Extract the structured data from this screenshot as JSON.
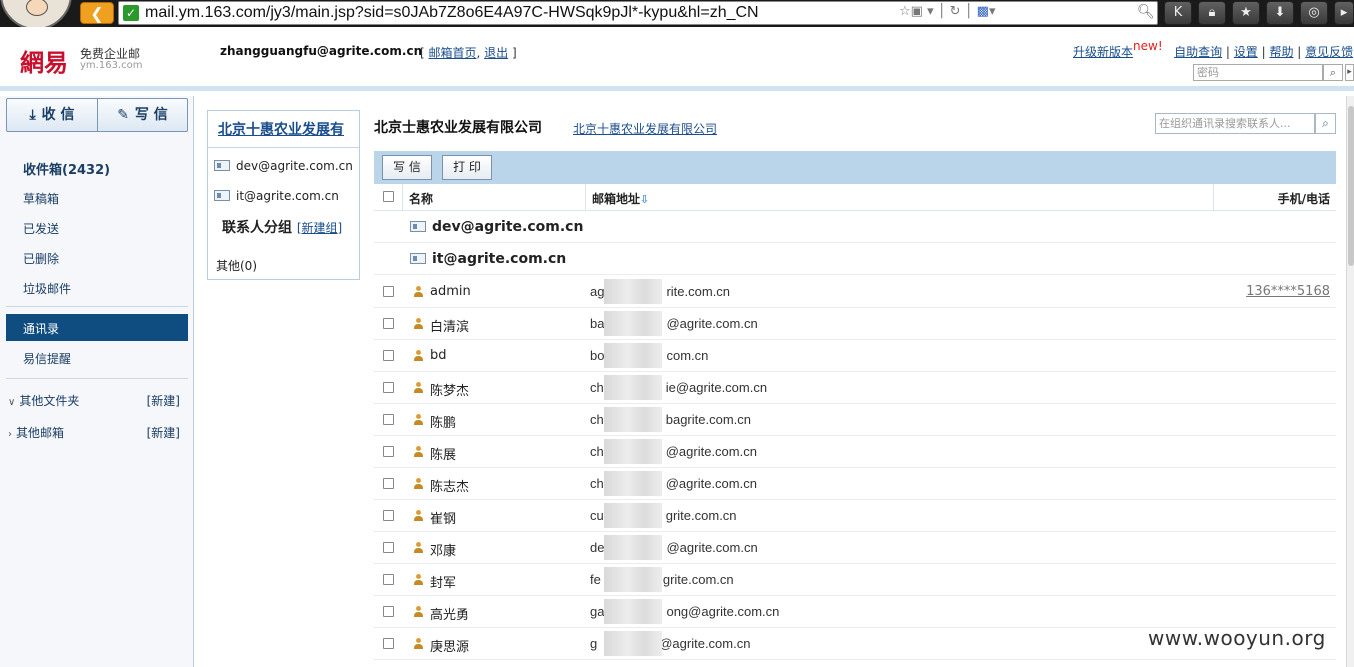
{
  "browser": {
    "url": "mail.ym.163.com/jy3/main.jsp?sid=s0JAb7Z8o6E4A97C-HWSqk9pJl*-kypu&hl=zh_CN"
  },
  "header": {
    "logo": "網易",
    "logo_sub": "免费企业邮",
    "logo_domain": "ym.163.com",
    "user_email": "zhangguangfu@agrite.com.cn",
    "link_home": "邮箱首页",
    "link_logout": "退出",
    "link_upgrade": "升级新版本",
    "new_badge": "new!",
    "link_help_self": "自助查询",
    "link_settings": "设置",
    "link_help": "帮助",
    "link_feedback": "意见反馈",
    "password_placeholder": "密码"
  },
  "sidebar": {
    "receive_label": "收 信",
    "compose_label": "写 信",
    "items": [
      {
        "label": "收件箱(2432)"
      },
      {
        "label": "草稿箱"
      },
      {
        "label": "已发送"
      },
      {
        "label": "已删除"
      },
      {
        "label": "垃圾邮件"
      }
    ],
    "active_item": "通讯录",
    "item_reminder": "易信提醒",
    "folders": [
      {
        "label": "其他文件夹",
        "new": "[新建]"
      },
      {
        "label": "其他邮箱",
        "new": "[新建]"
      }
    ]
  },
  "org_panel": {
    "title": "北京十惠农业发展有",
    "depts": [
      {
        "label": "dev@agrite.com.cn"
      },
      {
        "label": "it@agrite.com.cn"
      }
    ],
    "group_title": "联系人分组",
    "group_new": "[新建组]",
    "group_other": "其他(0)"
  },
  "main": {
    "title": "北京士惠农业发展有限公司",
    "sublink": "北京十惠农业发展有限公司",
    "search_placeholder": "在组织通讯录搜索联系人...",
    "toolbar": {
      "write": "写 信",
      "print": "打 印"
    },
    "columns": {
      "name": "名称",
      "email": "邮箱地址",
      "phone": "手机/电话"
    },
    "groups": [
      {
        "name": "dev@agrite.com.cn"
      },
      {
        "name": "it@agrite.com.cn"
      }
    ],
    "rows": [
      {
        "name": "admin",
        "email_start": "ag",
        "email_end": "rite.com.cn",
        "phone": "136****5168"
      },
      {
        "name": "白清滨",
        "email_start": "ba",
        "email_end": "@agrite.com.cn",
        "phone": ""
      },
      {
        "name": "bd",
        "email_start": "bo",
        "email_end": "com.cn",
        "phone": ""
      },
      {
        "name": "陈梦杰",
        "email_start": "ch",
        "email_end": "ie@agrite.com.cn",
        "phone": ""
      },
      {
        "name": "陈鹏",
        "email_start": "ch",
        "email_end": "bagrite.com.cn",
        "phone": ""
      },
      {
        "name": "陈展",
        "email_start": "ch",
        "email_end": "@agrite.com.cn",
        "phone": ""
      },
      {
        "name": "陈志杰",
        "email_start": "ch",
        "email_end": "@agrite.com.cn",
        "phone": ""
      },
      {
        "name": "崔钢",
        "email_start": "cu",
        "email_end": "grite.com.cn",
        "phone": ""
      },
      {
        "name": "邓康",
        "email_start": "de",
        "email_end": "@agrite.com.cn",
        "phone": ""
      },
      {
        "name": "封军",
        "email_start": "fe",
        "email_end": "grite.com.cn",
        "phone": ""
      },
      {
        "name": "高光勇",
        "email_start": "ga",
        "email_end": "ong@agrite.com.cn",
        "phone": ""
      },
      {
        "name": "庚思源",
        "email_start": "g",
        "email_end": "@agrite.com.cn",
        "phone": ""
      }
    ]
  },
  "watermark": "www.wooyun.org"
}
